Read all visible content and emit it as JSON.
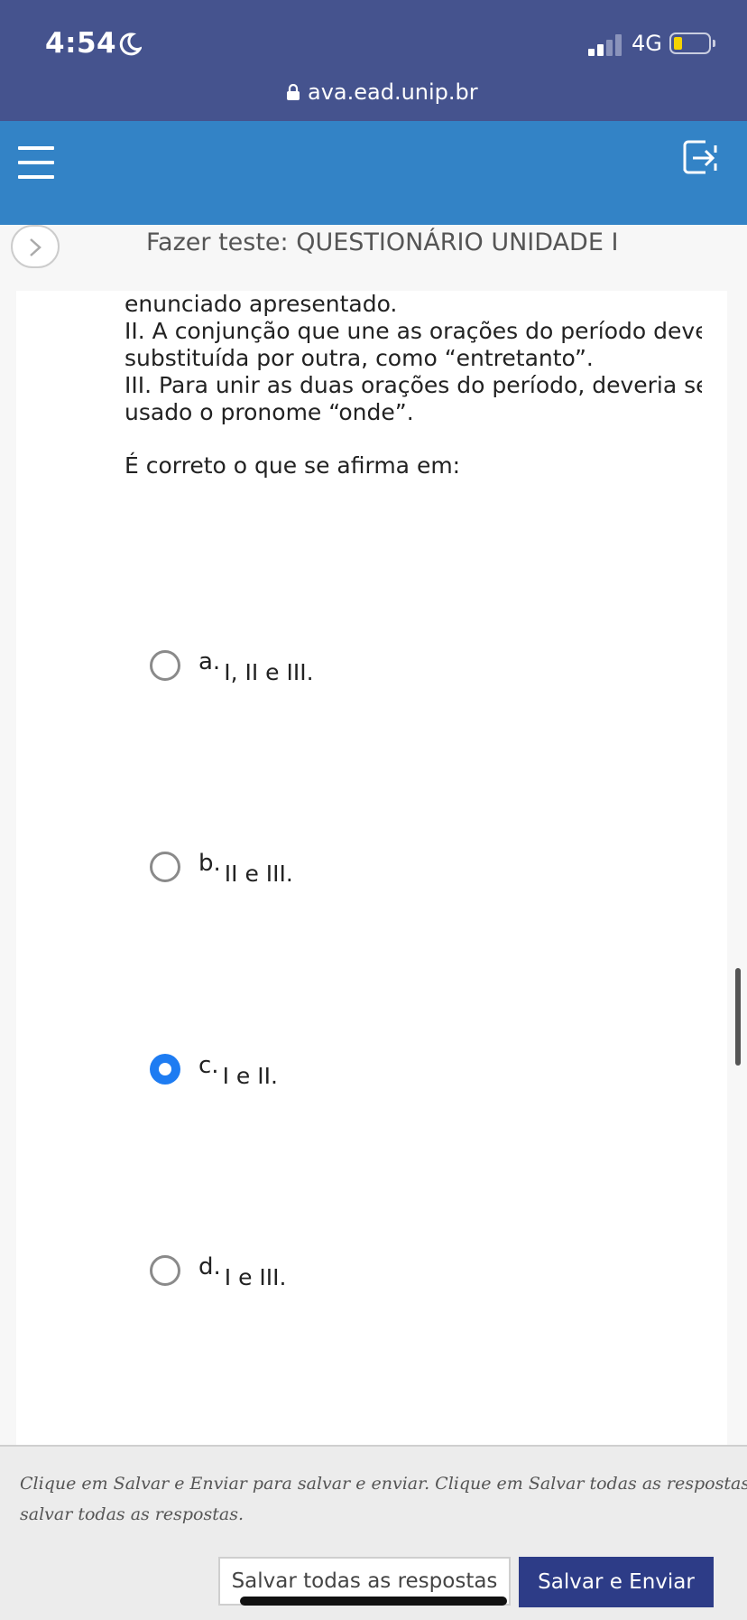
{
  "status_bar": {
    "time": "4:54",
    "network": "4G",
    "icons": [
      "moon-icon",
      "signal-icon",
      "battery-icon"
    ]
  },
  "browser": {
    "url": "ava.ead.unip.br",
    "icons": [
      "lock-icon"
    ]
  },
  "header": {
    "icons": [
      "hamburger-menu-icon",
      "exit-icon"
    ],
    "accent": "#3383c6"
  },
  "page": {
    "title": "Fazer teste: QUESTIONÁRIO UNIDADE I"
  },
  "question": {
    "lines": [
      "enunciado apresentado.",
      "II. A conjunção que une as orações do período deve",
      "substituída por outra, como “entretanto”.",
      "III. Para unir as duas orações do período, deveria se",
      "usado o pronome “onde”."
    ],
    "prompt": "É correto o que se afirma em:",
    "options": [
      {
        "letter": "a.",
        "text": "I, II e III.",
        "selected": false
      },
      {
        "letter": "b.",
        "text": "II e III.",
        "selected": false
      },
      {
        "letter": "c.",
        "text": "I e II.",
        "selected": true
      },
      {
        "letter": "d.",
        "text": "I e III.",
        "selected": false
      }
    ]
  },
  "footer": {
    "note_line1": "Clique em Salvar e Enviar para salvar e enviar. Clique em Salvar todas as respostas para",
    "note_line2": "salvar todas as respostas.",
    "save_all_label": "Salvar todas as respostas",
    "submit_label": "Salvar e Enviar"
  },
  "colors": {
    "status_bar": "#45538e",
    "submit_button": "#2d3c87",
    "radio_selected": "#1e7cf2"
  }
}
